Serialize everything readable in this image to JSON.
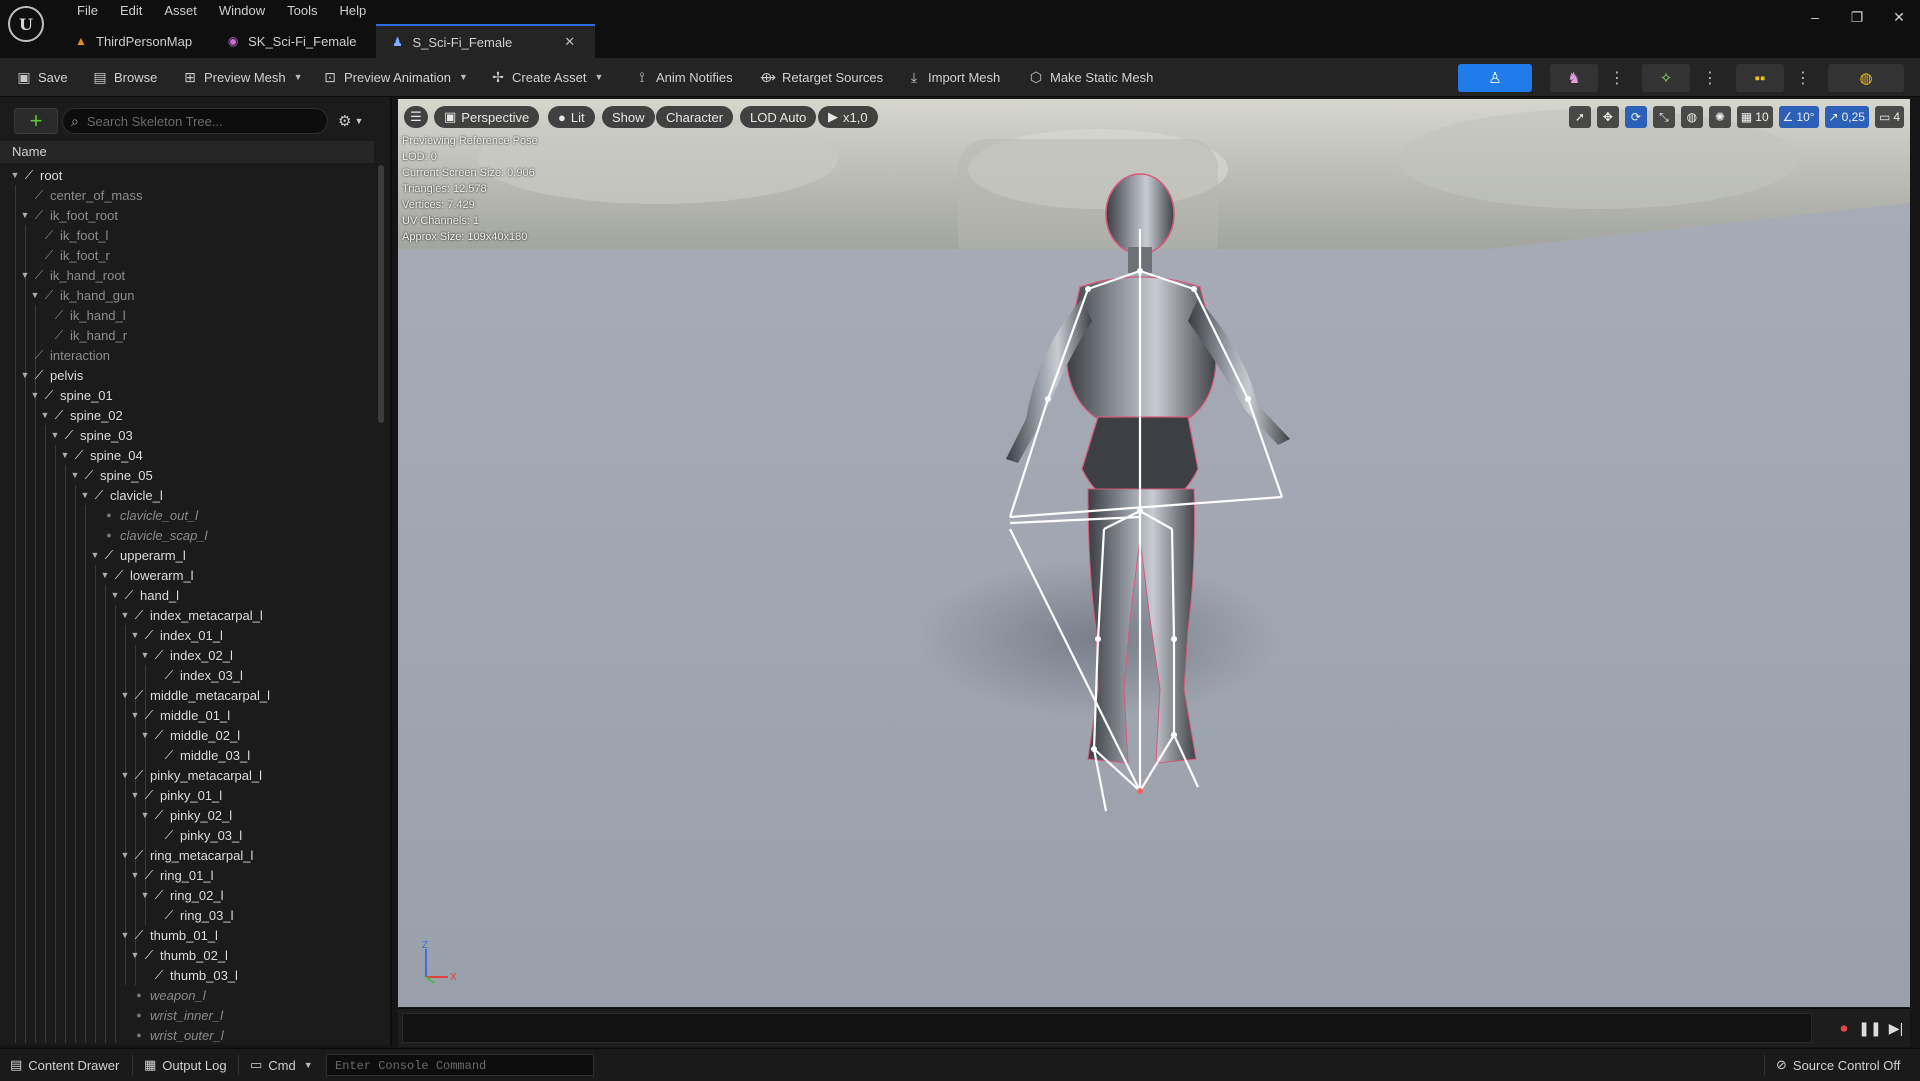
{
  "menu": [
    "File",
    "Edit",
    "Asset",
    "Window",
    "Tools",
    "Help"
  ],
  "tabs": [
    {
      "label": "ThirdPersonMap",
      "icon": "level-icon",
      "active": false
    },
    {
      "label": "SK_Sci-Fi_Female",
      "icon": "skeletal-mesh-icon",
      "active": false
    },
    {
      "label": "S_Sci-Fi_Female",
      "icon": "skeleton-icon",
      "active": true
    }
  ],
  "window_controls": {
    "minimize": "–",
    "restore": "❐",
    "close": "✕"
  },
  "toolbar": {
    "save": "Save",
    "browse": "Browse",
    "preview_mesh": "Preview Mesh",
    "preview_animation": "Preview Animation",
    "create_asset": "Create Asset",
    "anim_notifies": "Anim Notifies",
    "retarget_sources": "Retarget Sources",
    "import_mesh": "Import Mesh",
    "make_static_mesh": "Make Static Mesh"
  },
  "skeleton_tree": {
    "search_placeholder": "Search Skeleton Tree...",
    "header": "Name",
    "nodes": [
      {
        "label": "root",
        "depth": 0,
        "type": "bone",
        "exp": true
      },
      {
        "label": "center_of_mass",
        "depth": 1,
        "type": "dim",
        "exp": false
      },
      {
        "label": "ik_foot_root",
        "depth": 1,
        "type": "dim",
        "exp": true
      },
      {
        "label": "ik_foot_l",
        "depth": 2,
        "type": "dim",
        "exp": false
      },
      {
        "label": "ik_foot_r",
        "depth": 2,
        "type": "dim",
        "exp": false
      },
      {
        "label": "ik_hand_root",
        "depth": 1,
        "type": "dim",
        "exp": true
      },
      {
        "label": "ik_hand_gun",
        "depth": 2,
        "type": "dim",
        "exp": true
      },
      {
        "label": "ik_hand_l",
        "depth": 3,
        "type": "dim",
        "exp": false
      },
      {
        "label": "ik_hand_r",
        "depth": 3,
        "type": "dim",
        "exp": false
      },
      {
        "label": "interaction",
        "depth": 1,
        "type": "dim",
        "exp": false
      },
      {
        "label": "pelvis",
        "depth": 1,
        "type": "bone",
        "exp": true
      },
      {
        "label": "spine_01",
        "depth": 2,
        "type": "bone",
        "exp": true
      },
      {
        "label": "spine_02",
        "depth": 3,
        "type": "bone",
        "exp": true
      },
      {
        "label": "spine_03",
        "depth": 4,
        "type": "bone",
        "exp": true
      },
      {
        "label": "spine_04",
        "depth": 5,
        "type": "bone",
        "exp": true
      },
      {
        "label": "spine_05",
        "depth": 6,
        "type": "bone",
        "exp": true
      },
      {
        "label": "clavicle_l",
        "depth": 7,
        "type": "bone",
        "exp": true
      },
      {
        "label": "clavicle_out_l",
        "depth": 8,
        "type": "socket",
        "exp": false
      },
      {
        "label": "clavicle_scap_l",
        "depth": 8,
        "type": "socket",
        "exp": false
      },
      {
        "label": "upperarm_l",
        "depth": 8,
        "type": "bone",
        "exp": true
      },
      {
        "label": "lowerarm_l",
        "depth": 9,
        "type": "bone",
        "exp": true
      },
      {
        "label": "hand_l",
        "depth": 10,
        "type": "bone",
        "exp": true
      },
      {
        "label": "index_metacarpal_l",
        "depth": 11,
        "type": "bone",
        "exp": true
      },
      {
        "label": "index_01_l",
        "depth": 12,
        "type": "bone",
        "exp": true
      },
      {
        "label": "index_02_l",
        "depth": 13,
        "type": "bone",
        "exp": true
      },
      {
        "label": "index_03_l",
        "depth": 14,
        "type": "bone",
        "exp": false
      },
      {
        "label": "middle_metacarpal_l",
        "depth": 11,
        "type": "bone",
        "exp": true
      },
      {
        "label": "middle_01_l",
        "depth": 12,
        "type": "bone",
        "exp": true
      },
      {
        "label": "middle_02_l",
        "depth": 13,
        "type": "bone",
        "exp": true
      },
      {
        "label": "middle_03_l",
        "depth": 14,
        "type": "bone",
        "exp": false
      },
      {
        "label": "pinky_metacarpal_l",
        "depth": 11,
        "type": "bone",
        "exp": true
      },
      {
        "label": "pinky_01_l",
        "depth": 12,
        "type": "bone",
        "exp": true
      },
      {
        "label": "pinky_02_l",
        "depth": 13,
        "type": "bone",
        "exp": true
      },
      {
        "label": "pinky_03_l",
        "depth": 14,
        "type": "bone",
        "exp": false
      },
      {
        "label": "ring_metacarpal_l",
        "depth": 11,
        "type": "bone",
        "exp": true
      },
      {
        "label": "ring_01_l",
        "depth": 12,
        "type": "bone",
        "exp": true
      },
      {
        "label": "ring_02_l",
        "depth": 13,
        "type": "bone",
        "exp": true
      },
      {
        "label": "ring_03_l",
        "depth": 14,
        "type": "bone",
        "exp": false
      },
      {
        "label": "thumb_01_l",
        "depth": 11,
        "type": "bone",
        "exp": true
      },
      {
        "label": "thumb_02_l",
        "depth": 12,
        "type": "bone",
        "exp": true
      },
      {
        "label": "thumb_03_l",
        "depth": 13,
        "type": "bone",
        "exp": false
      },
      {
        "label": "weapon_l",
        "depth": 11,
        "type": "socket",
        "exp": false
      },
      {
        "label": "wrist_inner_l",
        "depth": 11,
        "type": "socket",
        "exp": false
      },
      {
        "label": "wrist_outer_l",
        "depth": 11,
        "type": "socket",
        "exp": false
      }
    ]
  },
  "viewport": {
    "perspective": "Perspective",
    "lit": "Lit",
    "show": "Show",
    "character": "Character",
    "lod": "LOD Auto",
    "play_speed": "x1,0",
    "stats": [
      "Previewing Reference Pose",
      "LOD: 0",
      "Current Screen Size: 0,906",
      "Triangles: 12.578",
      "Vertices: 7.429",
      "UV Channels: 1",
      "Approx Size: 109x40x180"
    ],
    "grid_snap": "10",
    "rotation_snap": "10°",
    "scale_snap": "0,25",
    "camera_speed": "4",
    "axis_z": "Z",
    "axis_x": "X"
  },
  "statusbar": {
    "content_drawer": "Content Drawer",
    "output_log": "Output Log",
    "cmd": "Cmd",
    "console_placeholder": "Enter Console Command",
    "source_control": "Source Control Off"
  },
  "colors": {
    "accent": "#2b6fe4",
    "add_green": "#5cc63a",
    "highlight": "#1f7ce8"
  }
}
